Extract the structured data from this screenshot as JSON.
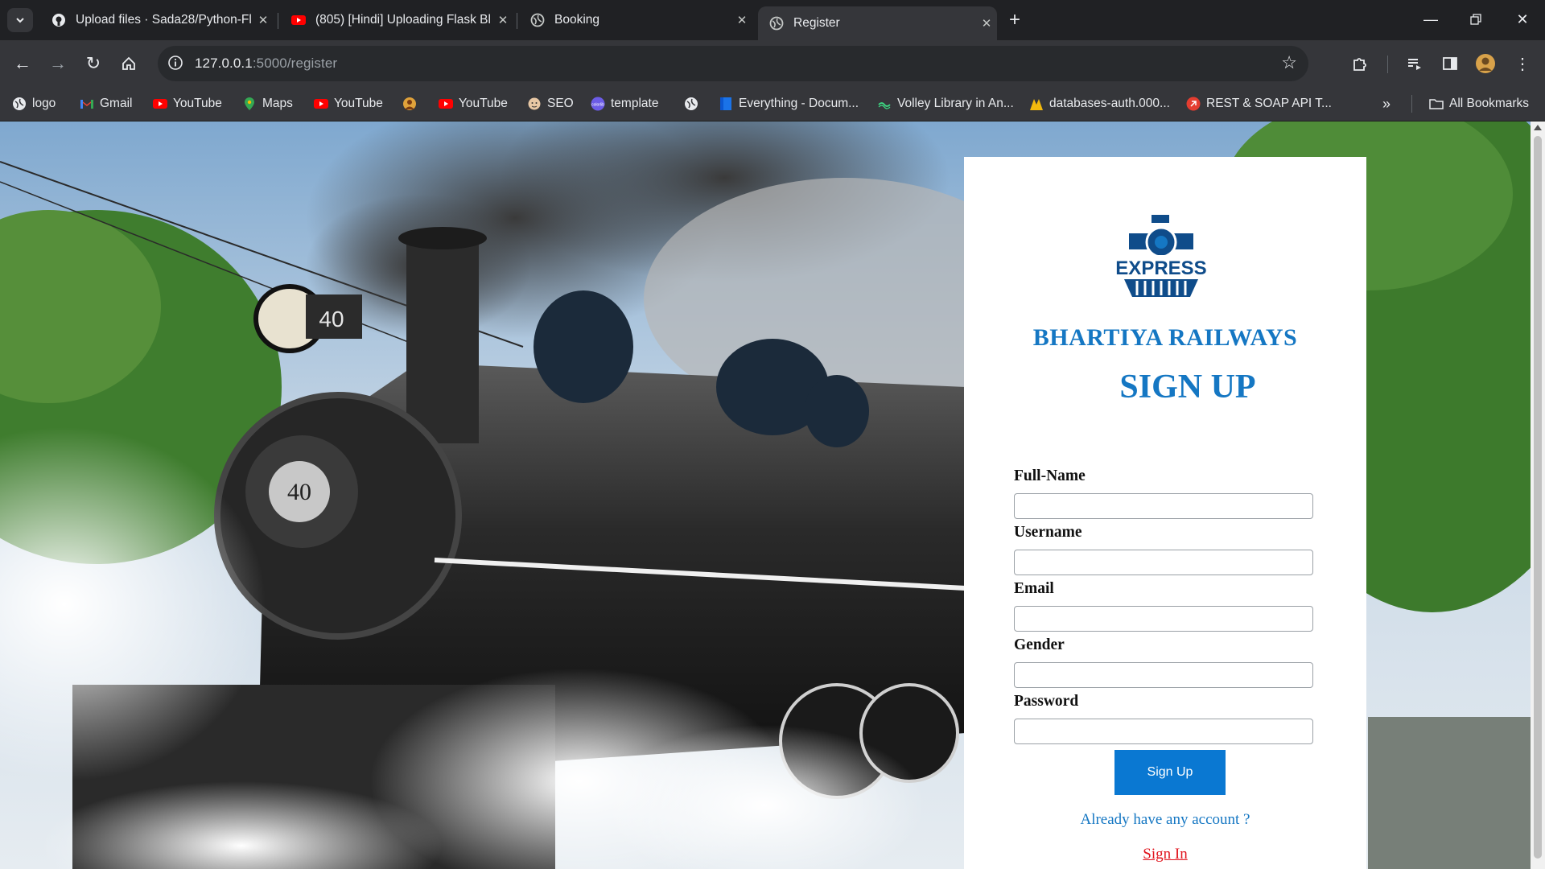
{
  "browser": {
    "tabs": [
      {
        "title": "Upload files · Sada28/Python-Fl",
        "icon": "github-icon",
        "active": false
      },
      {
        "title": "(805) [Hindi] Uploading Flask Bl",
        "icon": "youtube-icon",
        "active": false
      },
      {
        "title": "Booking",
        "icon": "globe-icon",
        "active": false
      },
      {
        "title": "Register",
        "icon": "globe-icon",
        "active": true
      }
    ],
    "address": {
      "host": "127.0.0.1",
      "path": ":5000/register"
    },
    "bookmarks": [
      {
        "label": "logo",
        "icon": "globe-icon"
      },
      {
        "label": "Gmail",
        "icon": "gmail-icon"
      },
      {
        "label": "YouTube",
        "icon": "youtube-icon"
      },
      {
        "label": "Maps",
        "icon": "maps-icon"
      },
      {
        "label": "YouTube",
        "icon": "youtube-icon"
      },
      {
        "label": "",
        "icon": "avatar-icon"
      },
      {
        "label": "YouTube",
        "icon": "youtube-icon"
      },
      {
        "label": "SEO",
        "icon": "face-icon"
      },
      {
        "label": "template",
        "icon": "colorlib-icon"
      },
      {
        "label": "",
        "icon": "globe-icon"
      },
      {
        "label": "Everything - Docum...",
        "icon": "doc-icon"
      },
      {
        "label": "Volley Library in An...",
        "icon": "volley-icon"
      },
      {
        "label": "databases-auth.000...",
        "icon": "db-icon"
      },
      {
        "label": "REST & SOAP API T...",
        "icon": "api-icon"
      }
    ],
    "all_bookmarks_label": "All Bookmarks"
  },
  "page": {
    "brand": "BHARTIYA RAILWAYS",
    "heading": "SIGN UP",
    "logo_text": "EXPRESS",
    "fields": [
      {
        "label": "Full-Name",
        "value": ""
      },
      {
        "label": "Username",
        "value": ""
      },
      {
        "label": "Email",
        "value": ""
      },
      {
        "label": "Gender",
        "value": ""
      },
      {
        "label": "Password",
        "value": ""
      }
    ],
    "submit_label": "Sign Up",
    "already_text": "Already have any account ?",
    "signin_label": "Sign In",
    "colors": {
      "brand_blue": "#1577c3",
      "button_blue": "#0a78d2",
      "link_red": "#e0131c"
    }
  }
}
